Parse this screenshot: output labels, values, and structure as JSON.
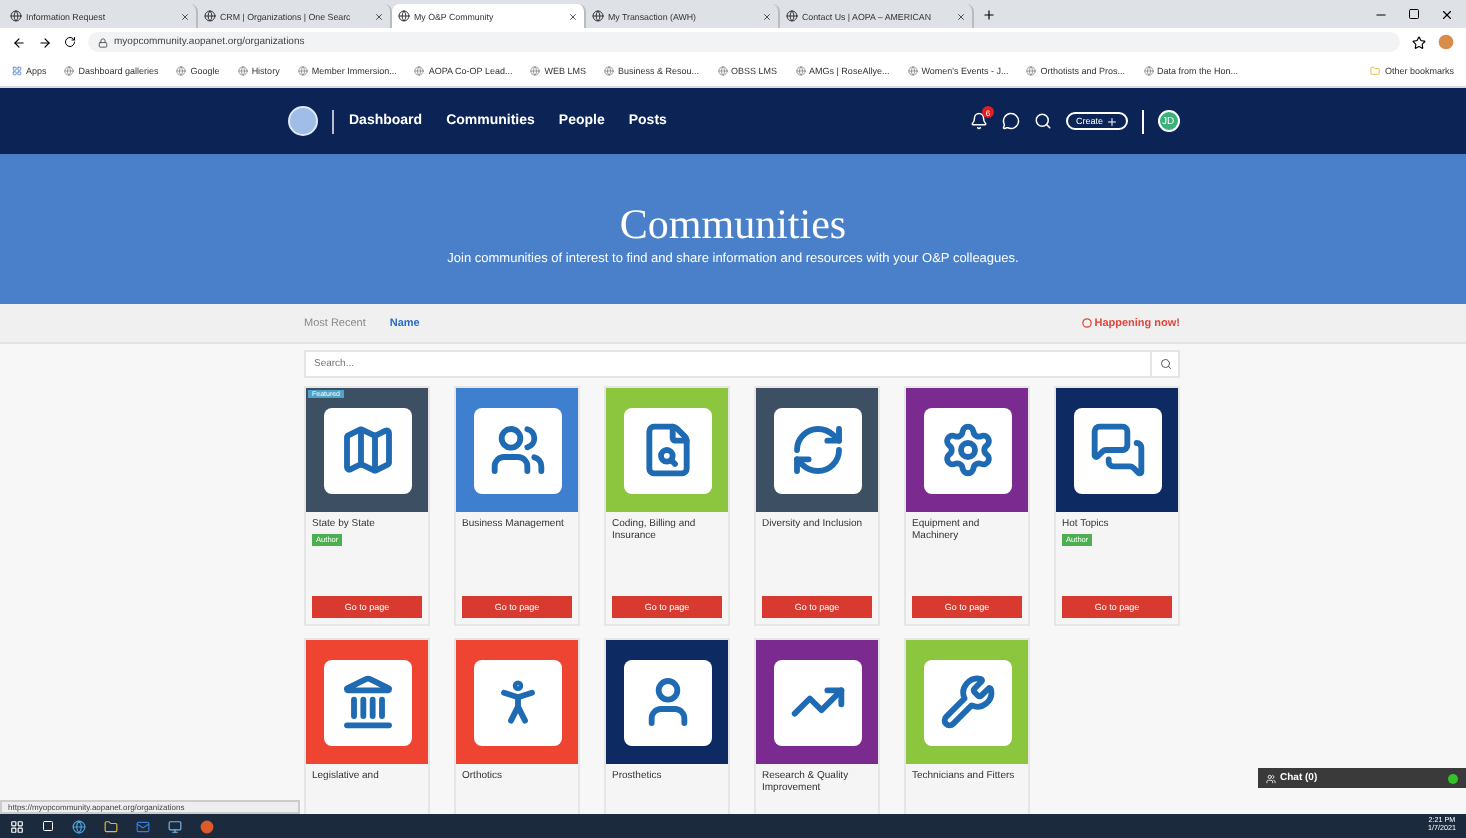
{
  "browser": {
    "tabs": [
      {
        "title": "Information Request",
        "selected": false
      },
      {
        "title": "CRM | Organizations | One Searc",
        "selected": false
      },
      {
        "title": "My O&P Community",
        "selected": true
      },
      {
        "title": "My Transaction (AWH)",
        "selected": false
      },
      {
        "title": "Contact Us | AOPA – AMERICAN",
        "selected": false
      }
    ],
    "url": "myopcommunity.aopanet.org/organizations",
    "bookmarks": [
      "Apps",
      "Dashboard galleries",
      "Google",
      "History",
      "Member Immersion...",
      "AOPA Co-OP Lead...",
      "WEB LMS",
      "Business & Resou...",
      "OBSS LMS",
      "AMGs | RoseAllye...",
      "Women's Events - J...",
      "Orthotists and Pros...",
      "Data from the Hon..."
    ],
    "other_bookmarks": "Other bookmarks"
  },
  "nav": {
    "links": [
      "Dashboard",
      "Communities",
      "People",
      "Posts"
    ],
    "notification_count": "6",
    "create_button": "Create",
    "avatar": "JD"
  },
  "hero": {
    "title": "Communities",
    "subtitle": "Join communities of interest to find and share information and resources with your O&P colleagues."
  },
  "sort_tabs": [
    {
      "label": "Most Recent",
      "selected": false
    },
    {
      "label": "Name",
      "selected": true
    }
  ],
  "happening_now": "Happening now!",
  "search": {
    "placeholder": "Search..."
  },
  "communities": [
    {
      "title": "State by State",
      "color": "#3d4f63",
      "tag": "Featured",
      "badge": "Author",
      "button": "Go to page"
    },
    {
      "title": "Business Management",
      "color": "#3f7fcf",
      "button": "Go to page"
    },
    {
      "title": "Coding, Billing and Insurance",
      "color": "#8cc63f",
      "button": "Go to page"
    },
    {
      "title": "Diversity and Inclusion",
      "color": "#3d4f63",
      "button": "Go to page"
    },
    {
      "title": "Equipment and Machinery",
      "color": "#7b2a8f",
      "button": "Go to page"
    },
    {
      "title": "Hot Topics",
      "color": "#0d2a63",
      "badge": "Author",
      "button": "Go to page"
    },
    {
      "title": "Legislative and",
      "color": "#f04432"
    },
    {
      "title": "Orthotics",
      "color": "#f04432"
    },
    {
      "title": "Prosthetics",
      "color": "#0d2a63"
    },
    {
      "title": "Research & Quality Improvement",
      "color": "#7b2a8f"
    },
    {
      "title": "Technicians and Fitters",
      "color": "#8cc63f"
    }
  ],
  "status_url": "https://myopcommunity.aopanet.org/organizations",
  "chat": {
    "label": "Chat (0)",
    "online": true
  },
  "taskbar": {
    "time": "2:21 PM",
    "date": "1/7/2021"
  }
}
